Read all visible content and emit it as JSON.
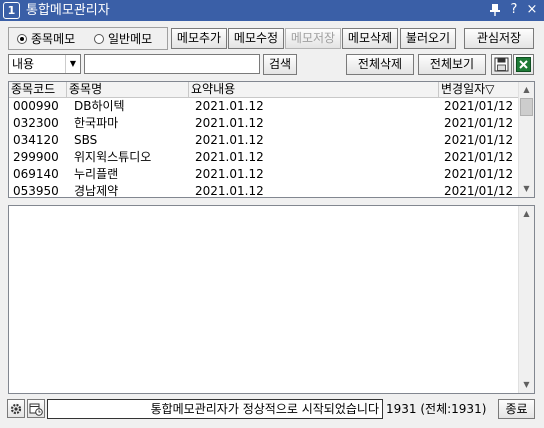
{
  "window": {
    "app_icon": "1",
    "title": "통합메모관리자",
    "pin_glyph": "⊥",
    "help_glyph": "?",
    "close_glyph": "×"
  },
  "memo_type": {
    "options": [
      "종목메모",
      "일반메모"
    ],
    "selected": "종목메모"
  },
  "toolbar": {
    "add": "메모추가",
    "edit": "메모수정",
    "save": "메모저장",
    "delete": "메모삭제",
    "load": "불러오기",
    "watchlist_save": "관심저장"
  },
  "search": {
    "field_value": "내용",
    "query": "",
    "search_button": "검색",
    "delete_all": "전체삭제",
    "view_all": "전체보기"
  },
  "icons": {
    "save_disk": "save-disk-icon",
    "excel": "excel-icon",
    "settings": "gear-icon",
    "schedule": "calendar-clock-icon"
  },
  "table": {
    "columns": [
      "종목코드",
      "종목명",
      "요약내용",
      "변경일자▽"
    ],
    "rows": [
      {
        "code": "000990",
        "name": "DB하이텍",
        "summary": "2021.01.12",
        "date": "2021/01/12"
      },
      {
        "code": "032300",
        "name": "한국파마",
        "summary": "2021.01.12",
        "date": "2021/01/12"
      },
      {
        "code": "034120",
        "name": "SBS",
        "summary": "2021.01.12",
        "date": "2021/01/12"
      },
      {
        "code": "299900",
        "name": "위지윅스튜디오",
        "summary": "2021.01.12",
        "date": "2021/01/12"
      },
      {
        "code": "069140",
        "name": "누리플랜",
        "summary": "2021.01.12",
        "date": "2021/01/12"
      },
      {
        "code": "053950",
        "name": "경남제약",
        "summary": "2021.01.12",
        "date": "2021/01/12"
      }
    ]
  },
  "memo_body": "",
  "status": {
    "message": "통합메모관리자가 정상적으로 시작되었습니다",
    "count_text": "1931 (전체:1931)",
    "close_button": "종료"
  },
  "colors": {
    "titlebar": "#3a5fa7",
    "excel_green": "#1e7a36"
  }
}
